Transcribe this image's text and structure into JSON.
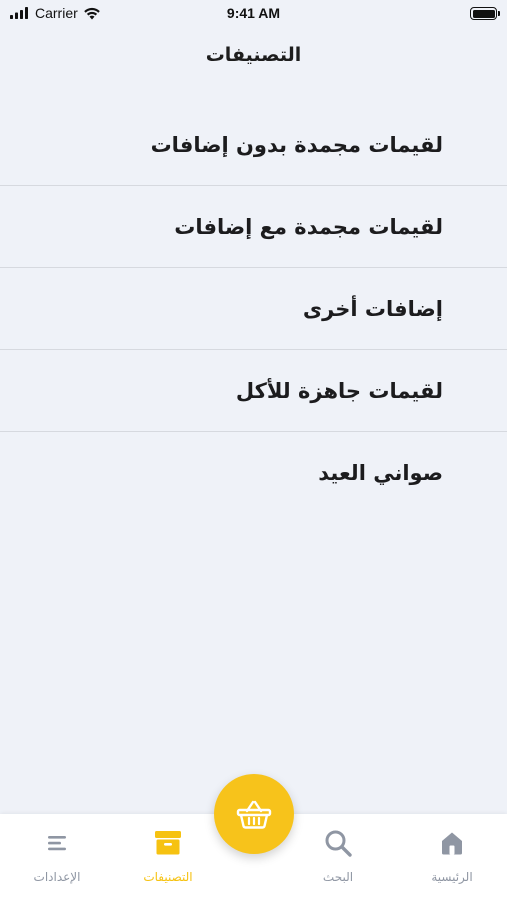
{
  "status_bar": {
    "carrier": "Carrier",
    "time": "9:41 AM"
  },
  "header": {
    "title": "التصنيفات"
  },
  "categories": [
    {
      "label": "لقيمات مجمدة بدون إضافات"
    },
    {
      "label": "لقيمات مجمدة مع إضافات"
    },
    {
      "label": "إضافات أخرى"
    },
    {
      "label": "لقيمات جاهزة للأكل"
    },
    {
      "label": "صواني العيد"
    }
  ],
  "tab_bar": {
    "tabs": [
      {
        "label": "الإعدادات",
        "icon": "menu-icon"
      },
      {
        "label": "التصنيفات",
        "icon": "archive-box-icon",
        "active": true
      },
      {
        "label": "البحث",
        "icon": "search-icon"
      },
      {
        "label": "الرئيسية",
        "icon": "home-icon"
      }
    ],
    "fab_icon": "basket-icon"
  },
  "colors": {
    "accent": "#f7c31b",
    "inactive": "#8f96a3",
    "background": "#eff2f8",
    "divider": "#d6d9df"
  }
}
